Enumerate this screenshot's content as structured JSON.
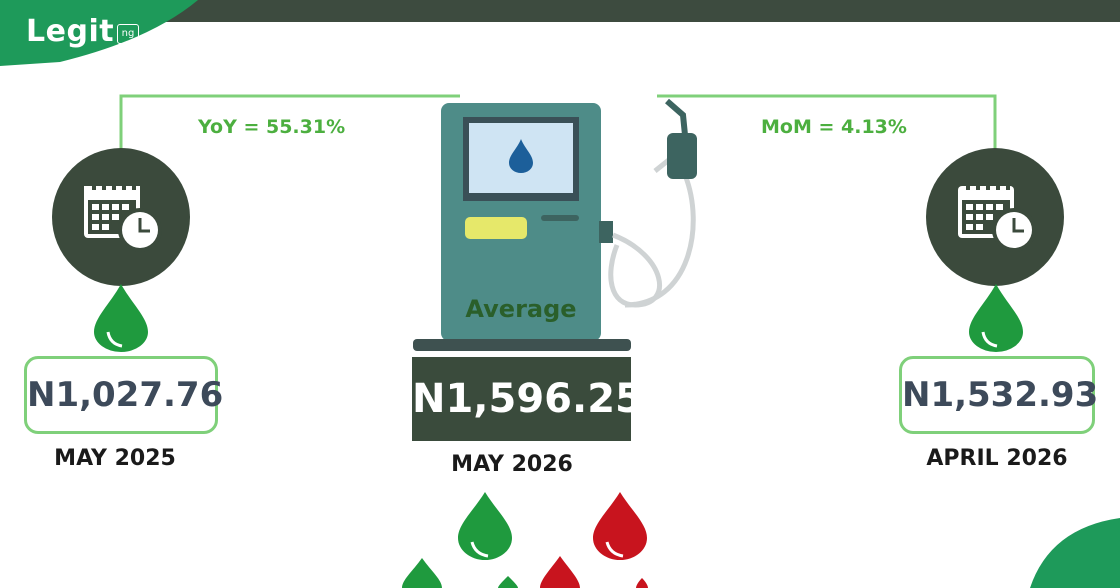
{
  "brand": {
    "logo_text": "Legit",
    "logo_badge": "ng"
  },
  "comparisons": {
    "yoy": {
      "label": "YoY = 55.31%"
    },
    "mom": {
      "label": "MoM =  4.13%"
    }
  },
  "left_card": {
    "price": "N1,027.76",
    "period": "MAY 2025",
    "icon": "calendar-clock-icon"
  },
  "center_card": {
    "pump_label": "Average",
    "price": "N1,596.25",
    "period": "MAY 2026",
    "icon": "fuel-pump-icon"
  },
  "right_card": {
    "price": "N1,532.93",
    "period": "APRIL 2026",
    "icon": "calendar-clock-icon"
  },
  "colors": {
    "dark_green": "#3b4a3c",
    "accent_green": "#4caf3f",
    "box_border": "#7fd07a",
    "pump_teal": "#4e8c88",
    "drop_green": "#1f9a3e",
    "drop_red": "#c8141e"
  }
}
